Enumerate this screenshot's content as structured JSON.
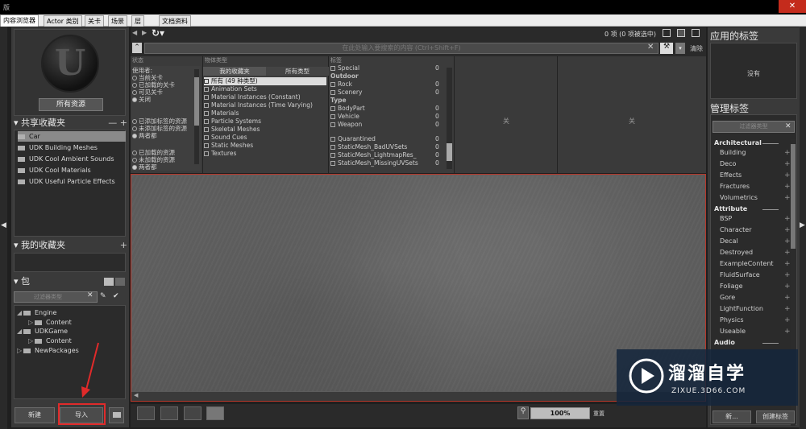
{
  "titlebar": {
    "icon_text": "版",
    "close_glyph": "✕"
  },
  "tabs": [
    "内容浏览器",
    "Actor 类别",
    "关卡",
    "场景",
    "层",
    "文档资料"
  ],
  "left": {
    "logo_letter": "U",
    "all_assets": "所有资源",
    "shared_fav_title": "共享收藏夹",
    "shared_fav_ctrl": "— +",
    "shared_items": [
      "Car",
      "UDK Building Meshes",
      "UDK Cool Ambient Sounds",
      "UDK Cool Materials",
      "UDK Useful Particle Effects"
    ],
    "my_fav_title": "我的收藏夹",
    "my_fav_ctrl": "+",
    "packages_title": "包",
    "pkg_search_placeholder": "过滤器类型",
    "tree": [
      {
        "label": "Engine",
        "tri": "◢"
      },
      {
        "label": "Content",
        "tri": "▷"
      },
      {
        "label": "UDKGame",
        "tri": "◢"
      },
      {
        "label": "Content",
        "tri": "▷"
      },
      {
        "label": "NewPackages",
        "tri": "▷"
      }
    ],
    "new_btn": "新建",
    "import_btn": "导入"
  },
  "toolbar": {
    "count_text": "0 项 (0 项被选中)",
    "search_placeholder": "在此处输入要搜索的内容 (Ctrl+Shift+F)",
    "clear_label": "清除"
  },
  "filters": {
    "status": {
      "head": "状态",
      "g1_title": "使用者:",
      "g1": [
        "当前关卡",
        "已加载的关卡",
        "可见关卡",
        "关闭"
      ],
      "g2": [
        "已添加标签的资源",
        "未添加标签的资源",
        "两者都"
      ],
      "g3": [
        "已加载的资源",
        "未加载的资源",
        "两者都"
      ]
    },
    "types": {
      "head": "物体类型",
      "tab_fav": "我的收藏夹",
      "tab_all": "所有类型",
      "items": [
        "所有 (49 种类型)",
        "Animation Sets",
        "Material Instances (Constant)",
        "Material Instances (Time Varying)",
        "Materials",
        "Particle Systems",
        "Skeletal Meshes",
        "Sound Cues",
        "Static Meshes",
        "Textures"
      ]
    },
    "tags": {
      "head": "标签",
      "rows": [
        {
          "t": "item",
          "label": "Special",
          "n": "0"
        },
        {
          "t": "group",
          "label": "Outdoor"
        },
        {
          "t": "item",
          "label": "Rock",
          "n": "0"
        },
        {
          "t": "item",
          "label": "Scenery",
          "n": "0"
        },
        {
          "t": "group",
          "label": "Type"
        },
        {
          "t": "item",
          "label": "BodyPart",
          "n": "0"
        },
        {
          "t": "item",
          "label": "Vehicle",
          "n": "0"
        },
        {
          "t": "item",
          "label": "Weapon",
          "n": "0"
        },
        {
          "t": "gap",
          "label": ""
        },
        {
          "t": "item",
          "label": "Quarantined",
          "n": "0"
        },
        {
          "t": "item",
          "label": "StaticMesh_BadUVSets",
          "n": "0"
        },
        {
          "t": "item",
          "label": "StaticMesh_LightmapRes_",
          "n": "0"
        },
        {
          "t": "item",
          "label": "StaticMesh_MissingUVSets",
          "n": "0"
        }
      ]
    },
    "off1": "关",
    "off2": "关"
  },
  "bottom": {
    "zoom": "100%",
    "zoom_btn": "重置"
  },
  "right": {
    "applied_title": "应用的标签",
    "none_text": "没有",
    "manage_title": "管理标签",
    "filter_placeholder": "过滤器类型",
    "groups": [
      {
        "name": "Architectural",
        "items": [
          "Building",
          "Deco",
          "Effects",
          "Fractures",
          "Volumetrics"
        ]
      },
      {
        "name": "Attribute",
        "items": [
          "BSP",
          "Character",
          "Decal",
          "Destroyed",
          "ExampleContent",
          "FluidSurface",
          "Foliage",
          "Gore",
          "LightFunction",
          "Physics",
          "Useable"
        ]
      },
      {
        "name": "Audio",
        "items": []
      }
    ],
    "bottom_btn1": "新...",
    "bottom_btn2": "创建标签"
  },
  "watermark": {
    "title": "溜溜自学",
    "url": "ZIXUE.3D66.COM"
  },
  "colors": {
    "accent_red": "#e02a2a",
    "selection": "#8a8a8a",
    "close_red": "#c42b1c"
  }
}
